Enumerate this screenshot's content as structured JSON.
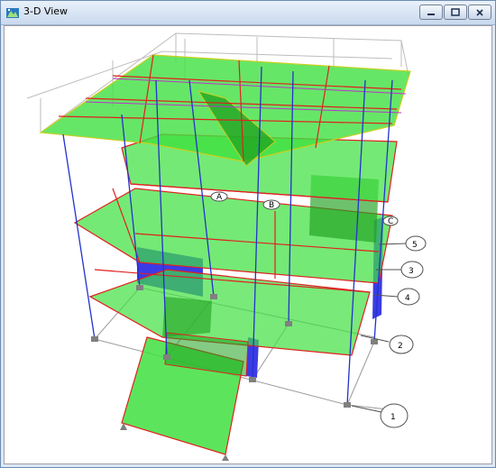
{
  "window": {
    "title": "3-D View",
    "icon": "structure-app-icon",
    "buttons": {
      "minimize": "minimize-icon",
      "maximize": "maximize-icon",
      "close": "close-icon"
    }
  },
  "view": {
    "grid_labels": [
      "1",
      "2",
      "4",
      "3",
      "5",
      "A",
      "B",
      "C"
    ],
    "colors": {
      "slab": "#33dd33",
      "slab_dark": "#1fa01f",
      "beam": "#e02020",
      "column": "#2233cc",
      "grid": "#a0a0a0",
      "wall": "#3a3ae0",
      "brace": "#bb33cc",
      "support": "#808080"
    }
  }
}
